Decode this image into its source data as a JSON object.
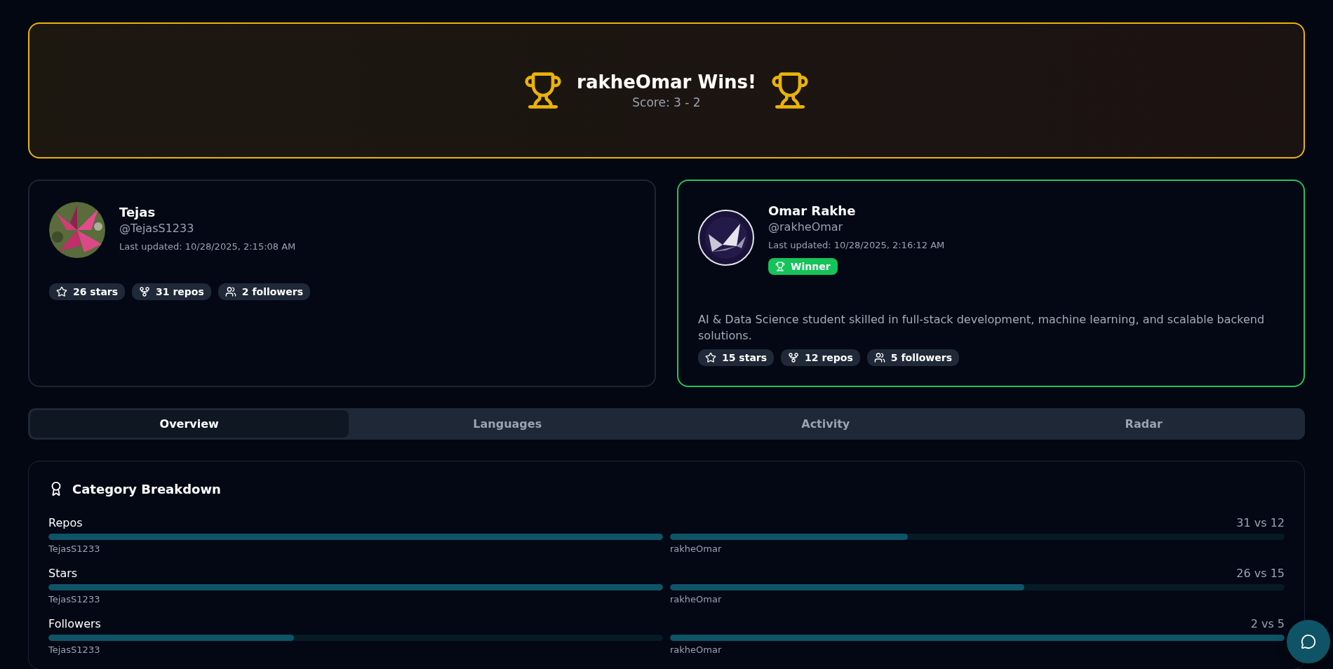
{
  "banner": {
    "title": "rakheOmar Wins!",
    "score": "Score: 3 - 2"
  },
  "players": [
    {
      "name": "Tejas",
      "handle": "@TejasS1233",
      "updated": "Last updated: 10/28/2025, 2:15:08 AM",
      "winner": false,
      "avatar": {
        "kind": "picture"
      },
      "stats": [
        {
          "kind": "stars",
          "label": "26 stars"
        },
        {
          "kind": "repos",
          "label": "31 repos"
        },
        {
          "kind": "followers",
          "label": "2 followers"
        }
      ]
    },
    {
      "name": "Omar Rakhe",
      "handle": "@rakheOmar",
      "updated": "Last updated: 10/28/2025, 2:16:12 AM",
      "winner": true,
      "badge": "Winner",
      "avatar": {
        "kind": "picture"
      },
      "bio": "AI & Data Science student skilled in full-stack development, machine learning, and scalable backend solutions.",
      "stats": [
        {
          "kind": "stars",
          "label": "15 stars"
        },
        {
          "kind": "repos",
          "label": "12 repos"
        },
        {
          "kind": "followers",
          "label": "5 followers"
        }
      ]
    }
  ],
  "tabs": [
    {
      "label": "Overview",
      "selected": true
    },
    {
      "label": "Languages",
      "selected": false
    },
    {
      "label": "Activity",
      "selected": false
    },
    {
      "label": "Radar",
      "selected": false
    }
  ],
  "breakdown": {
    "title": "Category Breakdown",
    "categories": [
      {
        "name": "Repos",
        "reading": "31 vs 12",
        "left": {
          "user": "TejasS1233",
          "level": 1
        },
        "right": {
          "user": "rakheOmar",
          "level": 0.387
        }
      },
      {
        "name": "Stars",
        "reading": "26 vs 15",
        "left": {
          "user": "TejasS1233",
          "level": 1
        },
        "right": {
          "user": "rakheOmar",
          "level": 0.577
        }
      },
      {
        "name": "Followers",
        "reading": "2 vs 5",
        "left": {
          "user": "TejasS1233",
          "level": 0.4
        },
        "right": {
          "user": "rakheOmar",
          "level": 1
        }
      }
    ]
  }
}
